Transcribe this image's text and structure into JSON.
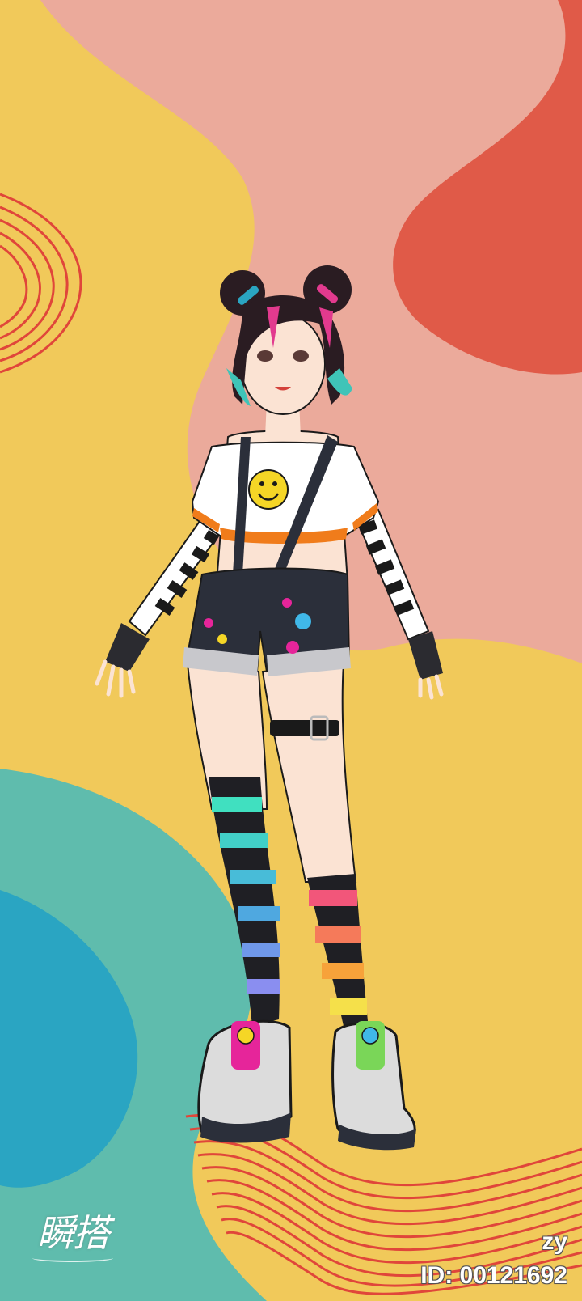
{
  "watermark": {
    "logo_text": "瞬搭",
    "user_name": "zy",
    "user_id": "ID: 00121692"
  },
  "palette": {
    "yellow": "#f1c95a",
    "pink": "#ebaa9b",
    "red": "#e05a48",
    "teal": "#5fbcad",
    "blue": "#2aa5c2",
    "line_red": "#e0463a"
  },
  "character": {
    "description_icon": "character-illustration",
    "hair_colors": [
      "#2a1c22",
      "#e23a8e",
      "#3fc4b8"
    ],
    "top_color": "#ffffff",
    "accent_orange": "#f07c1b",
    "shorts_color": "#2b2f3a",
    "sock_stripes_left": [
      "#40e0c0",
      "#4fa8e0",
      "#8a8ef0"
    ],
    "sock_stripes_right": [
      "#f2567a",
      "#f7a23a",
      "#f5e04a"
    ]
  }
}
